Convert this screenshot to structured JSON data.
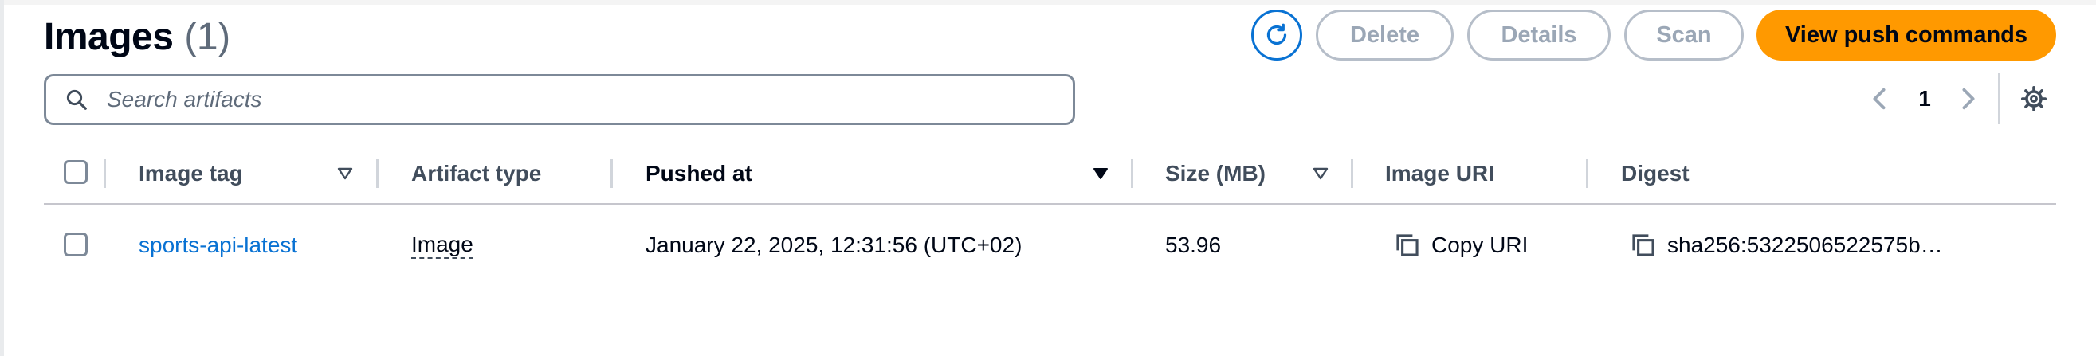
{
  "header": {
    "title": "Images",
    "count": "(1)"
  },
  "toolbar": {
    "delete_label": "Delete",
    "details_label": "Details",
    "scan_label": "Scan",
    "primary_label": "View push commands"
  },
  "search": {
    "placeholder": "Search artifacts",
    "value": ""
  },
  "pagination": {
    "current_page": "1"
  },
  "table": {
    "columns": [
      {
        "label": "Image tag",
        "sort": "sortable"
      },
      {
        "label": "Artifact type",
        "sort": "none"
      },
      {
        "label": "Pushed at",
        "sort": "descending"
      },
      {
        "label": "Size (MB)",
        "sort": "sortable"
      },
      {
        "label": "Image URI",
        "sort": "none"
      },
      {
        "label": "Digest",
        "sort": "none"
      }
    ],
    "rows": [
      {
        "image_tag": "sports-api-latest",
        "artifact_type": "Image",
        "pushed_at": "January 22, 2025, 12:31:56 (UTC+02)",
        "size_mb": "53.96",
        "image_uri": "Copy URI",
        "digest": "sha256:5322506522575b…"
      }
    ]
  },
  "colors": {
    "primary": "#ff9900",
    "link": "#0972d3",
    "disabled_text": "#9ba7b6",
    "text": "#000716"
  },
  "icons": [
    "refresh-icon",
    "search-icon",
    "chevron-left-icon",
    "chevron-right-icon",
    "settings-gear-icon",
    "sort-icon",
    "copy-icon"
  ]
}
